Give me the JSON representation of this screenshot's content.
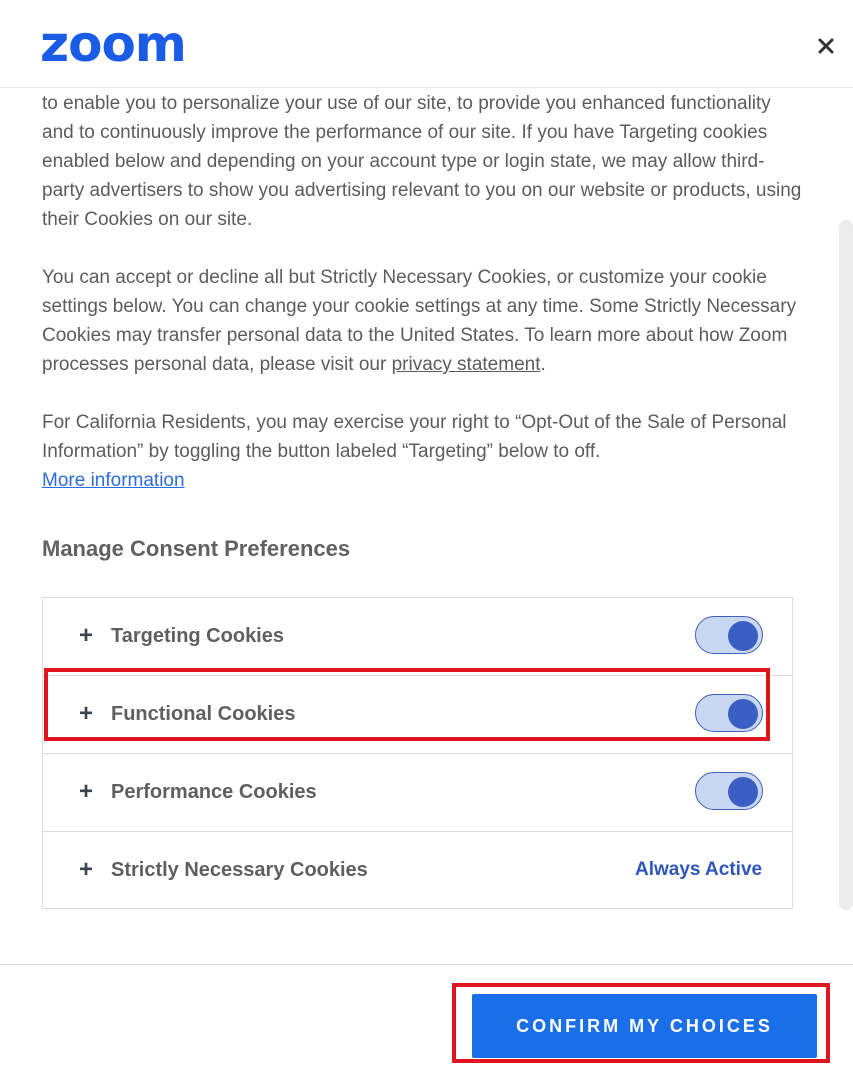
{
  "header": {
    "logo_text": "zoom",
    "close_icon": "close-icon"
  },
  "body": {
    "para1": "to enable you to personalize your use of our site, to provide you enhanced functionality and to continuously improve the performance of our site. If you have Targeting cookies enabled below and depending on your account type or login state, we may allow third-party advertisers to show you advertising relevant to you on our website or products, using their Cookies on our site.",
    "para2": "You can accept or decline all but Strictly Necessary Cookies, or customize your cookie settings below. You can change your cookie settings at any time. Some Strictly Necessary Cookies may transfer personal data to the United States. To learn more about how Zoom processes personal data, please visit our ",
    "privacy_link": "privacy statement",
    "para2_end": ".",
    "para3": "For California Residents, you may exercise your right to “Opt-Out of the Sale of Personal Information” by toggling the button labeled “Targeting” below to off.",
    "more_info_link": "More information"
  },
  "preferences": {
    "title": "Manage Consent Preferences",
    "items": [
      {
        "plus": "+",
        "label": "Targeting Cookies",
        "enabled": true
      },
      {
        "plus": "+",
        "label": "Functional Cookies",
        "enabled": true
      },
      {
        "plus": "+",
        "label": "Performance Cookies",
        "enabled": true
      },
      {
        "plus": "+",
        "label": "Strictly Necessary Cookies",
        "status": "Always Active"
      }
    ]
  },
  "footer": {
    "confirm_label": "CONFIRM MY CHOICES"
  },
  "colors": {
    "brand": "#1a5ce6",
    "button": "#1a6fe8",
    "highlight": "#e0161f",
    "toggle_on": "#3a5ec4"
  }
}
